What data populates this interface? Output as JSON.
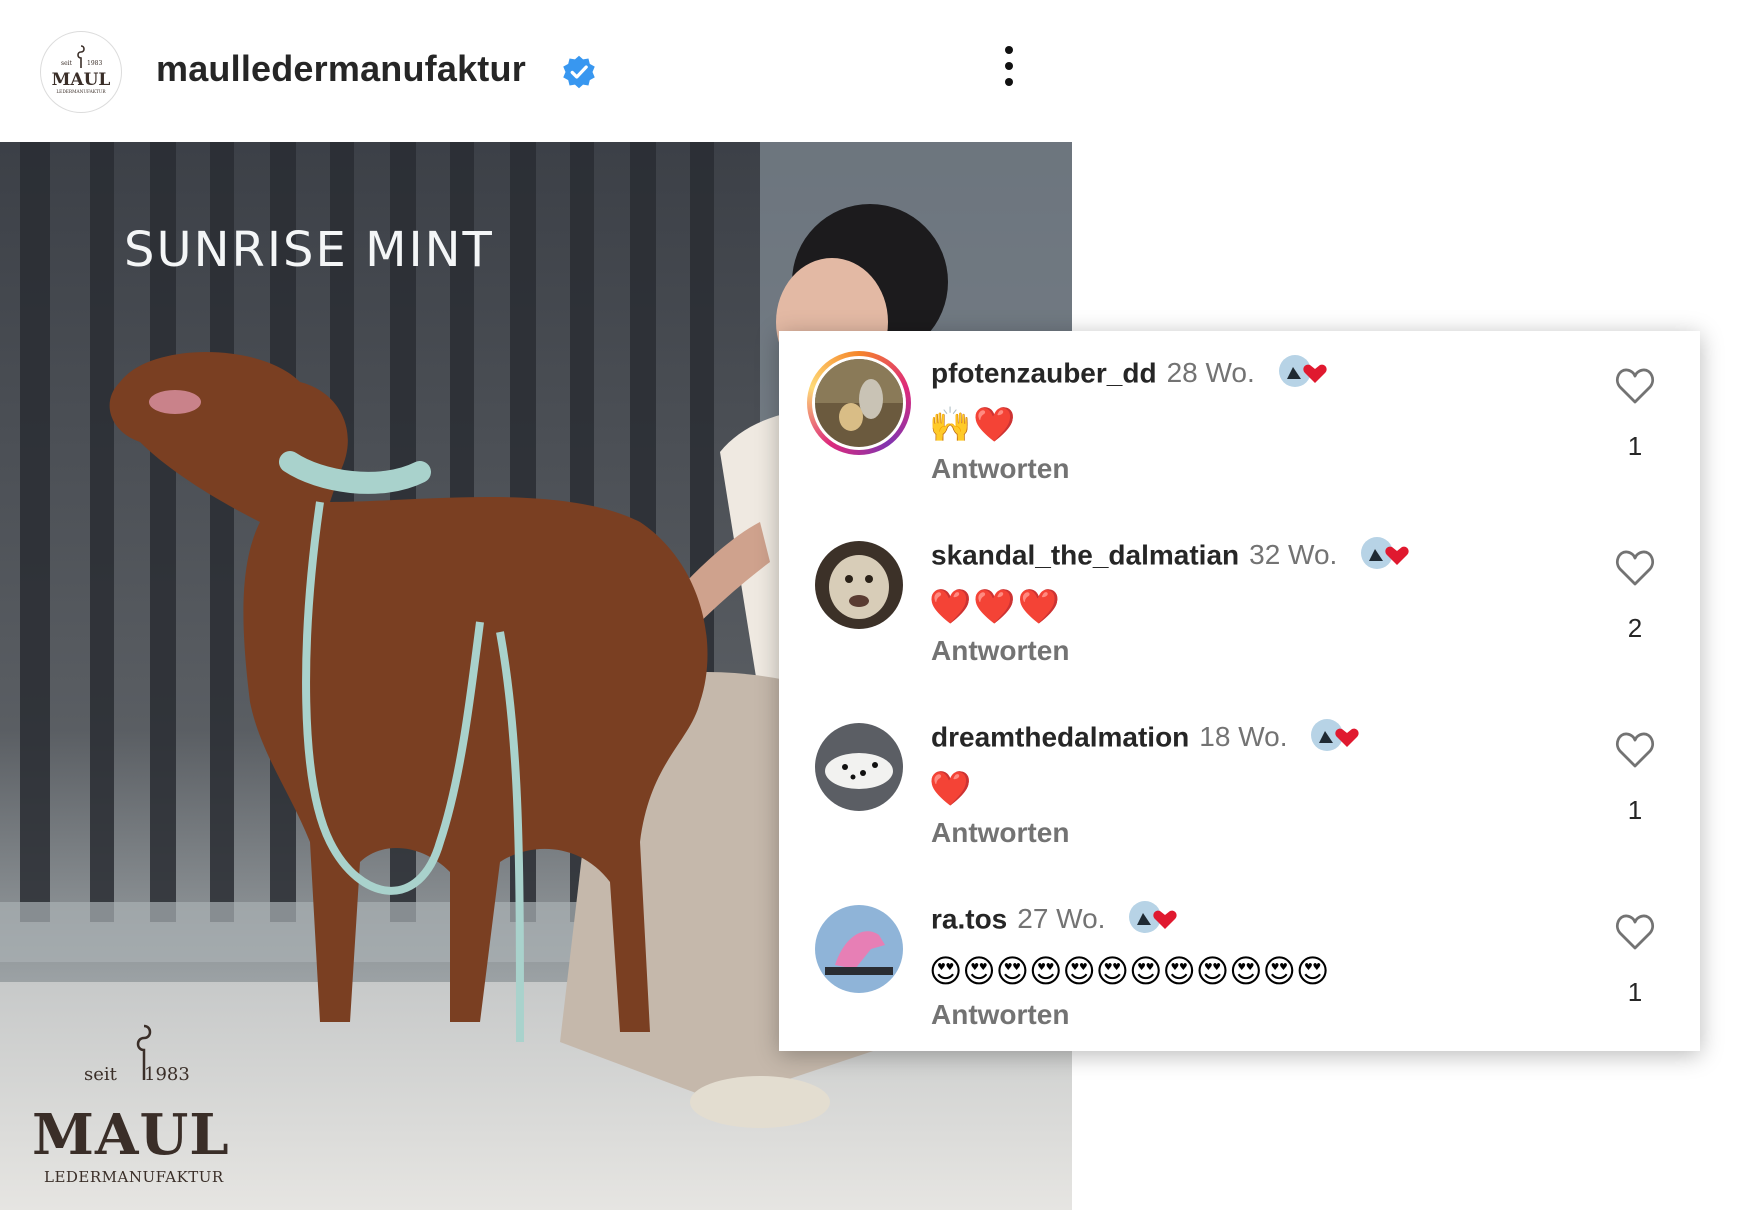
{
  "header": {
    "account_name": "maulledermanufaktur",
    "verified": true,
    "verified_color": "#3897f0",
    "avatar_icon": "maul-logo",
    "more_icon": "more-vertical-icon"
  },
  "post": {
    "title": "SUNRISE MINT",
    "brand": {
      "seit": "seit",
      "year": "1983",
      "word": "MAUL",
      "sub": "LEDERMANUFAKTUR"
    }
  },
  "comments": [
    {
      "username": "pfotenzauber_dd",
      "time": "28 Wo.",
      "text": "🙌❤️",
      "reply": "Antworten",
      "likes": "1",
      "story_ring": true
    },
    {
      "username": "skandal_the_dalmatian",
      "time": "32 Wo.",
      "text": "❤️❤️❤️",
      "reply": "Antworten",
      "likes": "2",
      "story_ring": false
    },
    {
      "username": "dreamthedalmation",
      "time": "18 Wo.",
      "text": "❤️",
      "reply": "Antworten",
      "likes": "1",
      "story_ring": false
    },
    {
      "username": "ra.tos",
      "time": "27 Wo.",
      "text": "😍😍😍😍😍😍😍😍😍😍😍😍",
      "reply": "Antworten",
      "likes": "1",
      "story_ring": false
    }
  ],
  "colors": {
    "text_primary": "#262626",
    "text_secondary": "#737373",
    "heart": "#e0192f"
  }
}
